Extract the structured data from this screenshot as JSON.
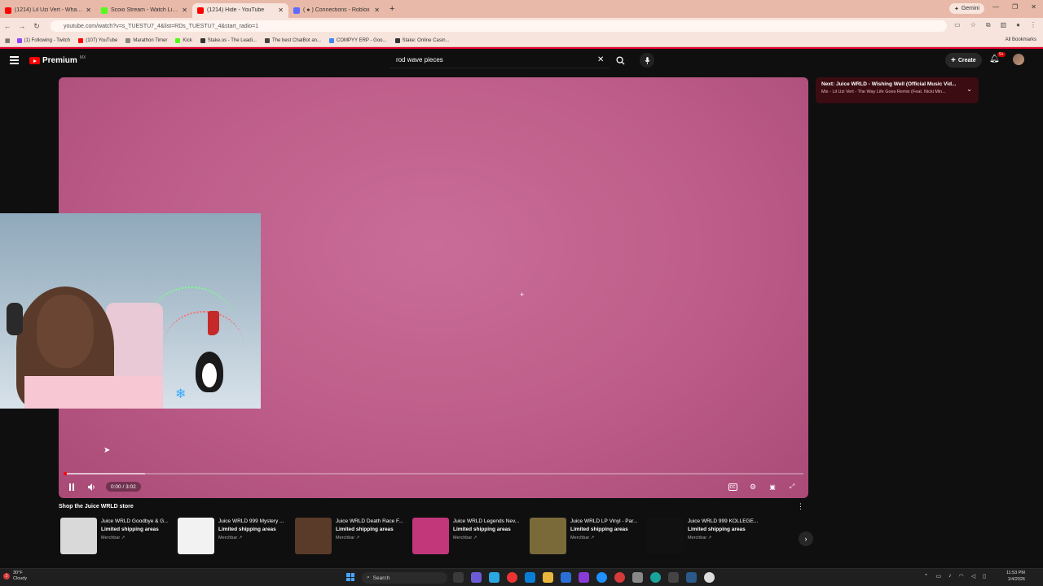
{
  "browser": {
    "tabs": [
      {
        "title": "(1214) Lil Uzi Vert - What You S",
        "color": "#ff0000",
        "active": false
      },
      {
        "title": "Scoio Stream - Watch Live on K",
        "color": "#53fc18",
        "active": false
      },
      {
        "title": "(1214) Hide - YouTube",
        "color": "#ff0000",
        "active": true
      },
      {
        "title": "( ● ) Connections - Roblox",
        "color": "#5b6cff",
        "active": false
      }
    ],
    "gemini_label": "Gemini",
    "url": "youtube.com/watch?v=s_TUESTU7_4&list=RDs_TUESTU7_4&start_radio=1",
    "bookmarks": [
      {
        "label": "(1) Following - Twitch",
        "color": "#9146ff"
      },
      {
        "label": "(107) YouTube",
        "color": "#ff0000"
      },
      {
        "label": "Marathon Timer",
        "color": "#888888"
      },
      {
        "label": "Kick",
        "color": "#53fc18"
      },
      {
        "label": "Stake.us - The Leadi...",
        "color": "#333333"
      },
      {
        "label": "The best ChatBot an...",
        "color": "#444444"
      },
      {
        "label": "COMPYY ERP - Goo...",
        "color": "#4285f4"
      },
      {
        "label": "Stake: Online Casin...",
        "color": "#333333"
      }
    ],
    "all_bookmarks": "All Bookmarks"
  },
  "youtube": {
    "logo_text": "Premium",
    "logo_sup": "MX",
    "search_value": "rod wave pieces",
    "create_label": "Create",
    "notif_badge": "9+",
    "player": {
      "time": "0:00 / 3:02",
      "progress": 0.004,
      "buffered": 0.11
    },
    "up_next": {
      "title": "Next: Juice WRLD - Wishing Well (Official Music Vid...",
      "subtitle": "Mix - Lil Uzi Vert - The Way Life Goes Remix (Feat. Nicki Min..."
    },
    "shelf": {
      "title": "Shop the Juice WRLD store",
      "items": [
        {
          "name": "Juice WRLD Goodbye & G...",
          "shipping": "Limited shipping areas",
          "source": "Merchbar ↗",
          "img_color": "#d9d9d9"
        },
        {
          "name": "Juice WRLD 999 Mystery ...",
          "shipping": "Limited shipping areas",
          "source": "Merchbar ↗",
          "img_color": "#f2f2f2"
        },
        {
          "name": "Juice WRLD Death Race F...",
          "shipping": "Limited shipping areas",
          "source": "Merchbar ↗",
          "img_color": "#5a3b2a"
        },
        {
          "name": "Juice WRLD Legends Nev...",
          "shipping": "Limited shipping areas",
          "source": "Merchbar ↗",
          "img_color": "#c2367a"
        },
        {
          "name": "Juice WRLD LP Vinyl - Par...",
          "shipping": "Limited shipping areas",
          "source": "Merchbar ↗",
          "img_color": "#7a6a3a"
        },
        {
          "name": "Juice WRLD 999 KOLLEGE...",
          "shipping": "Limited shipping areas",
          "source": "Merchbar ↗",
          "img_color": "#111111"
        }
      ]
    }
  },
  "taskbar": {
    "weather_temp": "30°F",
    "weather_desc": "Cloudy",
    "weather_badge": "3",
    "search_label": "Search",
    "time": "11:53 PM",
    "date": "1/4/2026"
  }
}
